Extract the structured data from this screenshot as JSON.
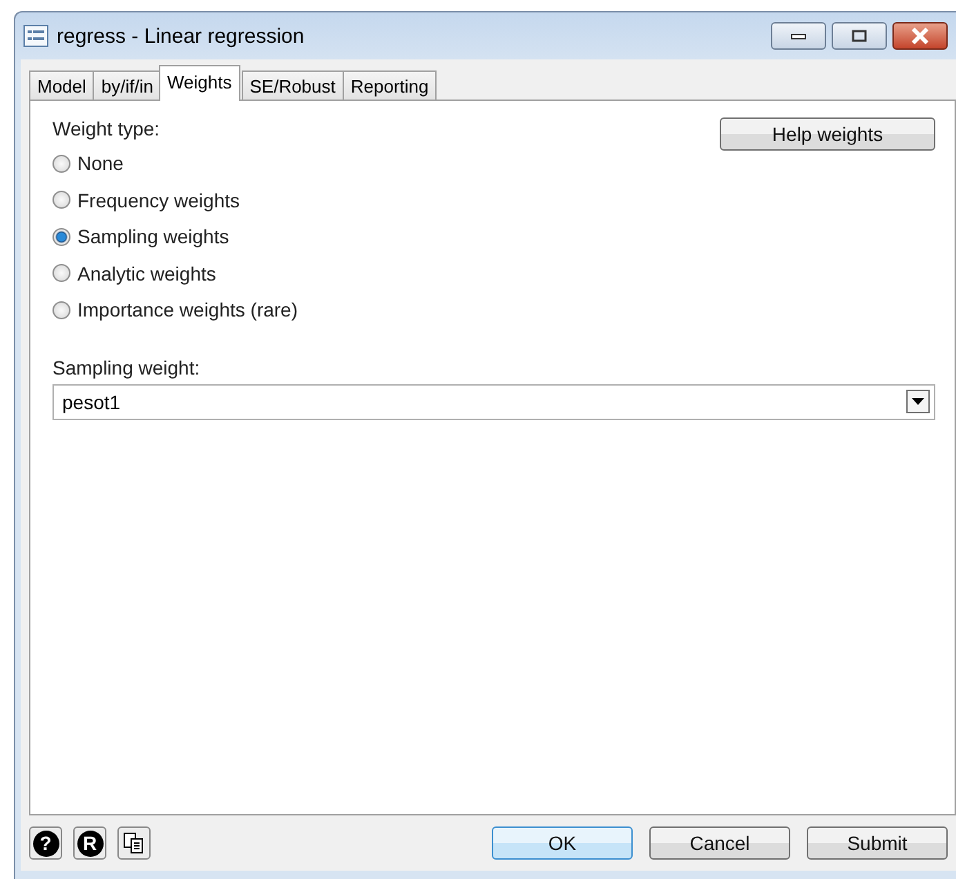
{
  "window": {
    "title": "regress - Linear regression"
  },
  "tabs": [
    {
      "label": "Model",
      "selected": false
    },
    {
      "label": "by/if/in",
      "selected": false
    },
    {
      "label": "Weights",
      "selected": true
    },
    {
      "label": "SE/Robust",
      "selected": false
    },
    {
      "label": "Reporting",
      "selected": false
    }
  ],
  "weight_type": {
    "label": "Weight type:",
    "options": [
      {
        "label": "None",
        "selected": false
      },
      {
        "label": "Frequency weights",
        "selected": false
      },
      {
        "label": "Sampling weights",
        "selected": true
      },
      {
        "label": "Analytic weights",
        "selected": false
      },
      {
        "label": "Importance weights (rare)",
        "selected": false
      }
    ]
  },
  "help_button": "Help weights",
  "sampling_weight": {
    "label": "Sampling weight:",
    "value": "pesot1"
  },
  "footer_icons": {
    "help": "?",
    "reset": "R"
  },
  "buttons": [
    "OK",
    "Cancel",
    "Submit"
  ]
}
